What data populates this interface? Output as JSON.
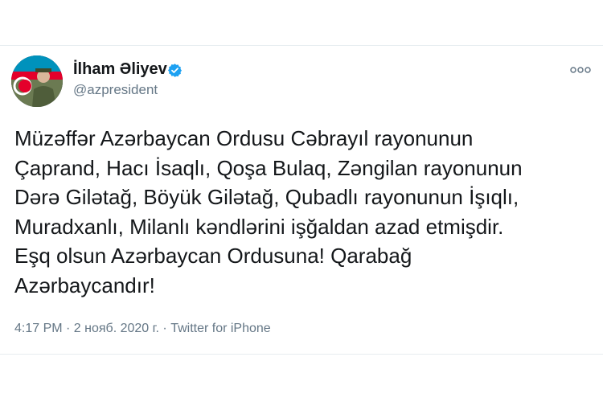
{
  "tweet": {
    "author_name": "İlham Əliyev",
    "handle": "@azpresident",
    "lines": [
      "Müzəffər Azərbaycan Ordusu Cəbrayıl rayonunun",
      "Çaprand, Hacı İsaqlı, Qoşa Bulaq, Zəngilan rayonunun",
      "Dərə Gilətağ, Böyük Gilətağ, Qubadlı rayonunun İşıqlı,",
      "Muradxanlı, Milanlı kəndlərini işğaldan azad etmişdir.",
      "Eşq olsun Azərbaycan Ordusuna! Qarabağ",
      "Azərbaycandır!"
    ],
    "timestamp": "4:17 PM · 2 нояб. 2020 г. · Twitter for iPhone",
    "icons": {
      "verified": "verified-badge-icon",
      "more": "more-options-icon"
    },
    "colors": {
      "verified": "#1da1f2",
      "secondary_text": "#657786",
      "divider": "#e6ecf0"
    }
  }
}
